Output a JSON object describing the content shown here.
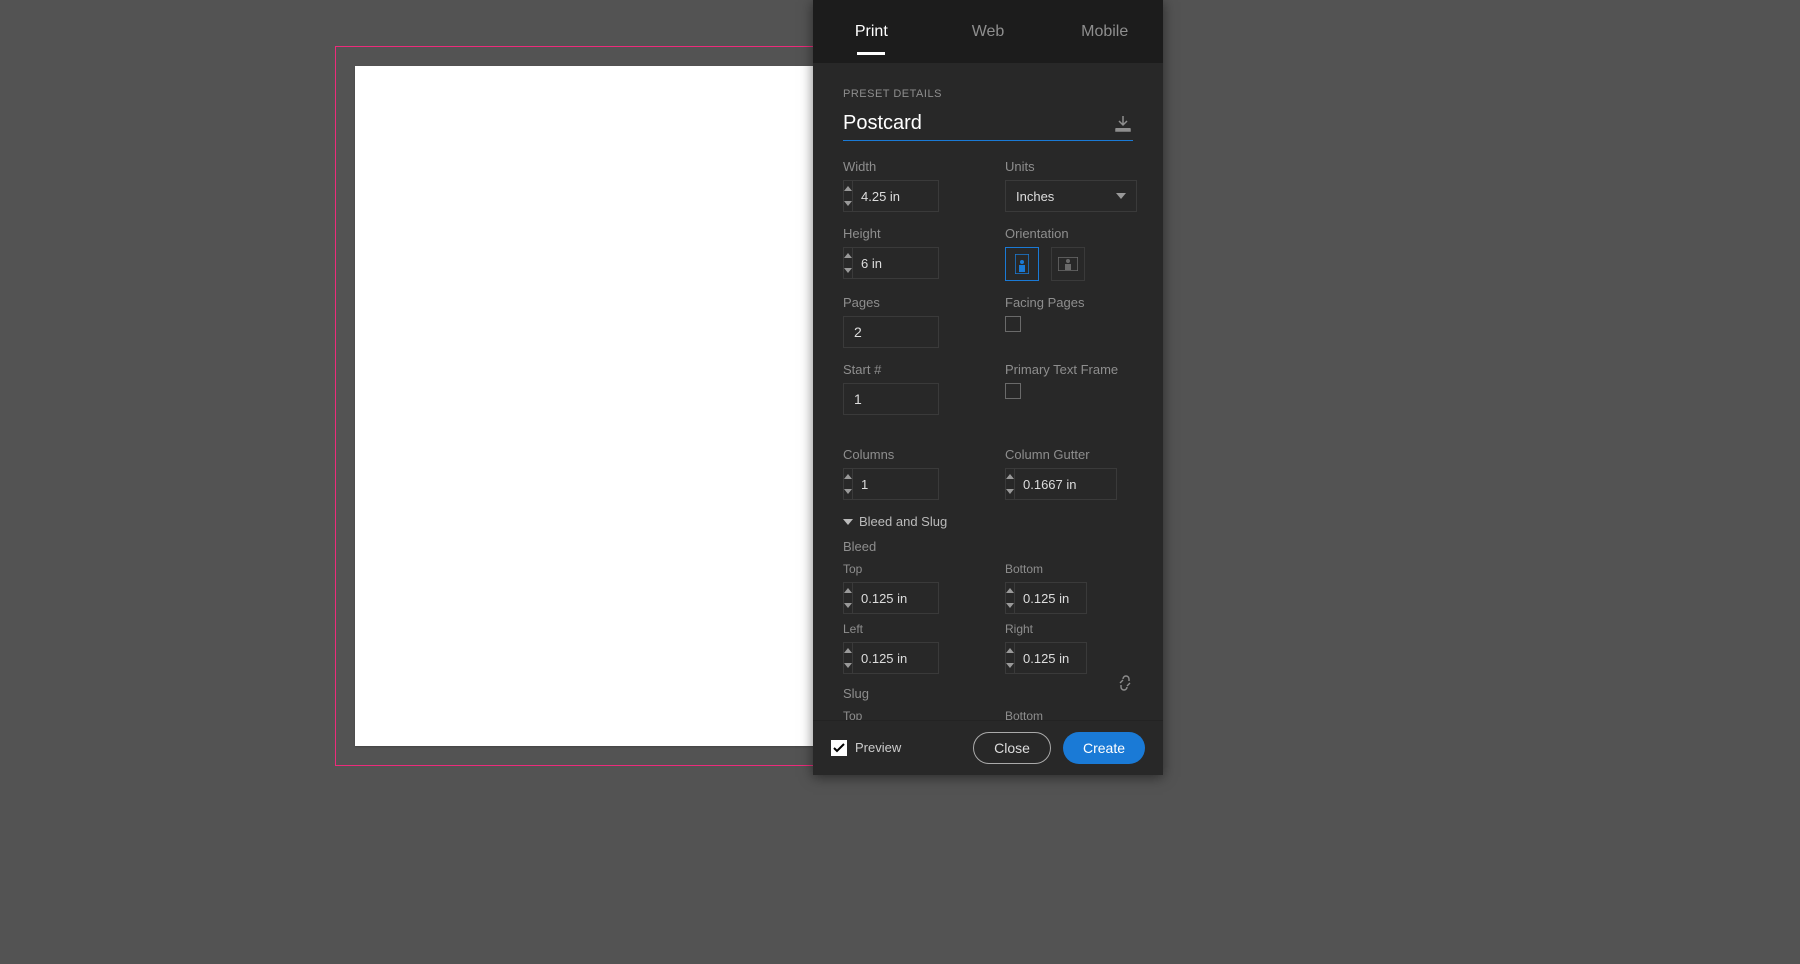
{
  "tabs": {
    "print": "Print",
    "web": "Web",
    "mobile": "Mobile",
    "active": "print"
  },
  "section_label": "PRESET DETAILS",
  "preset_name": "Postcard",
  "labels": {
    "width": "Width",
    "units": "Units",
    "height": "Height",
    "orientation": "Orientation",
    "pages": "Pages",
    "facing_pages": "Facing Pages",
    "start_num": "Start #",
    "primary_text_frame": "Primary Text Frame",
    "columns": "Columns",
    "column_gutter": "Column Gutter",
    "bleed_slug": "Bleed and Slug",
    "bleed": "Bleed",
    "top": "Top",
    "bottom": "Bottom",
    "left": "Left",
    "right": "Right",
    "slug": "Slug"
  },
  "values": {
    "width": "4.25 in",
    "height": "6 in",
    "units": "Inches",
    "pages": "2",
    "start_num": "1",
    "columns": "1",
    "column_gutter": "0.1667 in",
    "bleed_top": "0.125 in",
    "bleed_bottom": "0.125 in",
    "bleed_left": "0.125 in",
    "bleed_right": "0.125 in"
  },
  "checks": {
    "facing_pages": false,
    "primary_text_frame": false,
    "preview": true
  },
  "footer": {
    "preview": "Preview",
    "close": "Close",
    "create": "Create"
  }
}
